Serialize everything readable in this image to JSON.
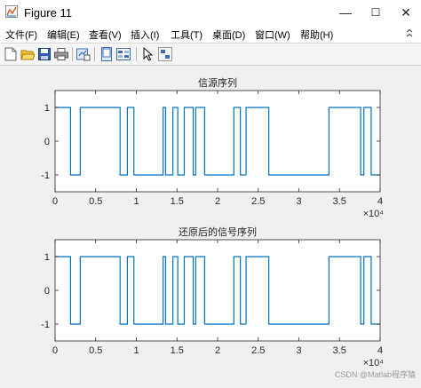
{
  "window": {
    "title": "Figure 11",
    "controls": {
      "minimize": "—",
      "maximize": "☐",
      "close": "✕"
    }
  },
  "menu": {
    "items": [
      "文件(F)",
      "编辑(E)",
      "查看(V)",
      "插入(I)",
      "工具(T)",
      "桌面(D)",
      "窗口(W)",
      "帮助(H)"
    ],
    "expand_icon": "chevron-icon"
  },
  "toolbar": {
    "buttons": [
      "new-figure-icon",
      "open-file-icon",
      "save-icon",
      "print-icon",
      "link-plot-icon",
      "dock-icon",
      "property-editor-icon",
      "pointer-icon",
      "arrange-icon"
    ]
  },
  "chart_data": [
    {
      "type": "line",
      "title": "信源序列",
      "xlim": [
        0,
        40000
      ],
      "ylim": [
        -1.5,
        1.5
      ],
      "xticks": [
        0,
        0.5,
        1,
        1.5,
        2,
        2.5,
        3,
        3.5,
        4
      ],
      "yticks": [
        -1,
        0,
        1
      ],
      "x_exponent": "×10⁴",
      "series": [
        {
          "color": "#0072BD",
          "x": [
            0,
            1900,
            1900,
            3100,
            3100,
            8000,
            8000,
            8900,
            8900,
            9700,
            9700,
            10000,
            10000,
            13300,
            13300,
            13600,
            13600,
            14500,
            14500,
            15100,
            15100,
            15900,
            15900,
            17000,
            17000,
            17300,
            17300,
            18400,
            18400,
            22000,
            22000,
            22800,
            22800,
            23500,
            23500,
            26300,
            26300,
            27200,
            27200,
            33700,
            33700,
            37600,
            37600,
            38000,
            38000,
            38900,
            38900,
            40000
          ],
          "y": [
            1,
            1,
            -1,
            -1,
            1,
            1,
            -1,
            -1,
            1,
            1,
            -1,
            -1,
            -1,
            -1,
            1,
            1,
            -1,
            -1,
            1,
            1,
            -1,
            -1,
            1,
            1,
            -1,
            -1,
            1,
            1,
            -1,
            -1,
            1,
            1,
            -1,
            -1,
            1,
            1,
            -1,
            -1,
            -1,
            -1,
            1,
            1,
            -1,
            -1,
            1,
            1,
            -1,
            -1
          ]
        }
      ]
    },
    {
      "type": "line",
      "title": "还原后的信号序列",
      "xlim": [
        0,
        40000
      ],
      "ylim": [
        -1.5,
        1.5
      ],
      "xticks": [
        0,
        0.5,
        1,
        1.5,
        2,
        2.5,
        3,
        3.5,
        4
      ],
      "yticks": [
        -1,
        0,
        1
      ],
      "x_exponent": "×10⁴",
      "series": [
        {
          "color": "#0072BD",
          "x": [
            0,
            1900,
            1900,
            3100,
            3100,
            8000,
            8000,
            8900,
            8900,
            9700,
            9700,
            10000,
            10000,
            13300,
            13300,
            13600,
            13600,
            14500,
            14500,
            15100,
            15100,
            15900,
            15900,
            17000,
            17000,
            17300,
            17300,
            18400,
            18400,
            22000,
            22000,
            22800,
            22800,
            23500,
            23500,
            26300,
            26300,
            27200,
            27200,
            33700,
            33700,
            37600,
            37600,
            38000,
            38000,
            38900,
            38900,
            40000
          ],
          "y": [
            1,
            1,
            -1,
            -1,
            1,
            1,
            -1,
            -1,
            1,
            1,
            -1,
            -1,
            -1,
            -1,
            1,
            1,
            -1,
            -1,
            1,
            1,
            -1,
            -1,
            1,
            1,
            -1,
            -1,
            1,
            1,
            -1,
            -1,
            1,
            1,
            -1,
            -1,
            1,
            1,
            -1,
            -1,
            -1,
            -1,
            1,
            1,
            -1,
            -1,
            1,
            1,
            -1,
            -1
          ]
        }
      ]
    }
  ],
  "watermark": "CSDN @Matlab程序猿"
}
